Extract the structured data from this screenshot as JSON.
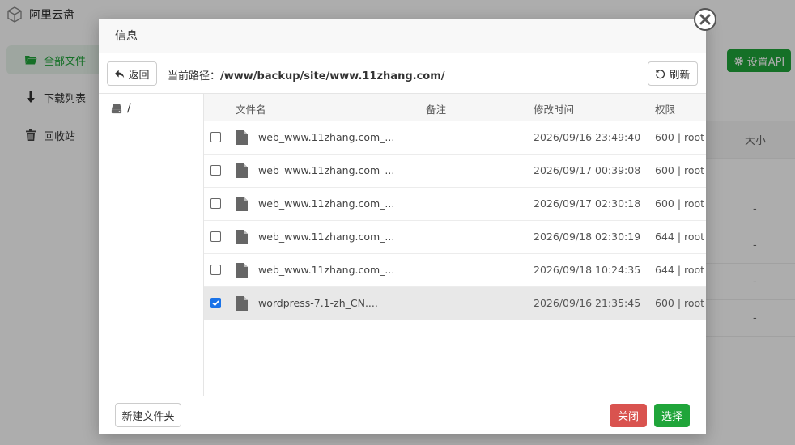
{
  "app": {
    "title": "阿里云盘",
    "sidebar": [
      {
        "label": "全部文件",
        "icon": "folder-open-icon",
        "active": true
      },
      {
        "label": "下载列表",
        "icon": "arrow-down-icon",
        "active": false
      },
      {
        "label": "回收站",
        "icon": "trash-icon",
        "active": false
      }
    ],
    "api_button": "设置API",
    "table_header_size": "大小",
    "rows_size": [
      "-",
      "-",
      "-",
      "-"
    ]
  },
  "dialog": {
    "title": "信息",
    "back_label": "返回",
    "path_label": "当前路径：",
    "path_value": "/www/backup/site/www.11zhang.com/",
    "refresh_label": "刷新",
    "tree_root": "/",
    "columns": {
      "name": "文件名",
      "note": "备注",
      "mtime": "修改时间",
      "perm": "权限"
    },
    "files": [
      {
        "name": "web_www.11zhang.com_...",
        "mtime": "2026/09/16 23:49:40",
        "perm": "600 | root",
        "checked": false
      },
      {
        "name": "web_www.11zhang.com_...",
        "mtime": "2026/09/17 00:39:08",
        "perm": "600 | root",
        "checked": false
      },
      {
        "name": "web_www.11zhang.com_...",
        "mtime": "2026/09/17 02:30:18",
        "perm": "600 | root",
        "checked": false
      },
      {
        "name": "web_www.11zhang.com_...",
        "mtime": "2026/09/18 02:30:19",
        "perm": "644 | root",
        "checked": false
      },
      {
        "name": "web_www.11zhang.com_...",
        "mtime": "2026/09/18 10:24:35",
        "perm": "644 | root",
        "checked": false
      },
      {
        "name": "wordpress-7.1-zh_CN....",
        "mtime": "2026/09/16 21:35:45",
        "perm": "600 | root",
        "checked": true
      }
    ],
    "new_folder_label": "新建文件夹",
    "close_label": "关闭",
    "select_label": "选择"
  },
  "colors": {
    "accent_green": "#20a53a",
    "danger_red": "#d9534f",
    "check_blue": "#1a73e8"
  }
}
